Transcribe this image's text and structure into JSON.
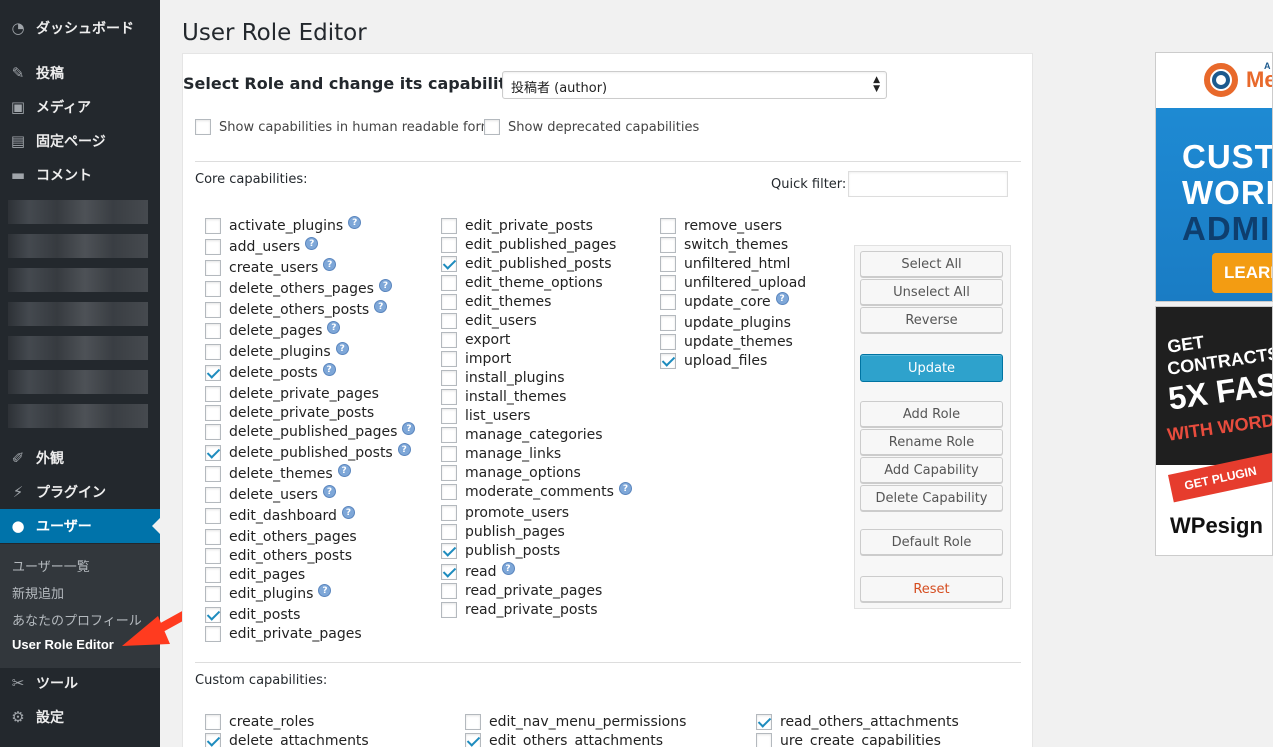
{
  "sidebar": {
    "items": [
      {
        "label": "ダッシュボード",
        "icon": "dashboard-icon"
      },
      {
        "label": "投稿",
        "icon": "pin-icon"
      },
      {
        "label": "メディア",
        "icon": "media-icon"
      },
      {
        "label": "固定ページ",
        "icon": "page-icon"
      },
      {
        "label": "コメント",
        "icon": "comment-icon"
      },
      {
        "label": "外観",
        "icon": "brush-icon"
      },
      {
        "label": "プラグイン",
        "icon": "plugin-icon"
      },
      {
        "label": "ユーザー",
        "icon": "users-icon"
      },
      {
        "label": "ツール",
        "icon": "wrench-icon"
      },
      {
        "label": "設定",
        "icon": "settings-icon"
      }
    ],
    "submenu": [
      "ユーザー一覧",
      "新規追加",
      "あなたのプロフィール",
      "User Role Editor"
    ]
  },
  "page": {
    "title": "User Role Editor",
    "role_label": "Select Role and change its capabilities:",
    "role_value": "投稿者 (author)",
    "human_readable_label": "Show capabilities in human readable form",
    "deprecated_label": "Show deprecated capabilities",
    "core_label": "Core capabilities:",
    "quick_filter_label": "Quick filter:",
    "custom_label": "Custom capabilities:"
  },
  "core_capabilities": {
    "col1": [
      {
        "name": "activate_plugins",
        "checked": false,
        "help": true
      },
      {
        "name": "add_users",
        "checked": false,
        "help": true
      },
      {
        "name": "create_users",
        "checked": false,
        "help": true
      },
      {
        "name": "delete_others_pages",
        "checked": false,
        "help": true
      },
      {
        "name": "delete_others_posts",
        "checked": false,
        "help": true
      },
      {
        "name": "delete_pages",
        "checked": false,
        "help": true
      },
      {
        "name": "delete_plugins",
        "checked": false,
        "help": true
      },
      {
        "name": "delete_posts",
        "checked": true,
        "help": true
      },
      {
        "name": "delete_private_pages",
        "checked": false,
        "help": false
      },
      {
        "name": "delete_private_posts",
        "checked": false,
        "help": false
      },
      {
        "name": "delete_published_pages",
        "checked": false,
        "help": true
      },
      {
        "name": "delete_published_posts",
        "checked": true,
        "help": true
      },
      {
        "name": "delete_themes",
        "checked": false,
        "help": true
      },
      {
        "name": "delete_users",
        "checked": false,
        "help": true
      },
      {
        "name": "edit_dashboard",
        "checked": false,
        "help": true
      },
      {
        "name": "edit_others_pages",
        "checked": false,
        "help": false
      },
      {
        "name": "edit_others_posts",
        "checked": false,
        "help": false
      },
      {
        "name": "edit_pages",
        "checked": false,
        "help": false
      },
      {
        "name": "edit_plugins",
        "checked": false,
        "help": true
      },
      {
        "name": "edit_posts",
        "checked": true,
        "help": false
      },
      {
        "name": "edit_private_pages",
        "checked": false,
        "help": false
      }
    ],
    "col2": [
      {
        "name": "edit_private_posts",
        "checked": false,
        "help": false
      },
      {
        "name": "edit_published_pages",
        "checked": false,
        "help": false
      },
      {
        "name": "edit_published_posts",
        "checked": true,
        "help": false
      },
      {
        "name": "edit_theme_options",
        "checked": false,
        "help": false
      },
      {
        "name": "edit_themes",
        "checked": false,
        "help": false
      },
      {
        "name": "edit_users",
        "checked": false,
        "help": false
      },
      {
        "name": "export",
        "checked": false,
        "help": false
      },
      {
        "name": "import",
        "checked": false,
        "help": false
      },
      {
        "name": "install_plugins",
        "checked": false,
        "help": false
      },
      {
        "name": "install_themes",
        "checked": false,
        "help": false
      },
      {
        "name": "list_users",
        "checked": false,
        "help": false
      },
      {
        "name": "manage_categories",
        "checked": false,
        "help": false
      },
      {
        "name": "manage_links",
        "checked": false,
        "help": false
      },
      {
        "name": "manage_options",
        "checked": false,
        "help": false
      },
      {
        "name": "moderate_comments",
        "checked": false,
        "help": true
      },
      {
        "name": "promote_users",
        "checked": false,
        "help": false
      },
      {
        "name": "publish_pages",
        "checked": false,
        "help": false
      },
      {
        "name": "publish_posts",
        "checked": true,
        "help": false
      },
      {
        "name": "read",
        "checked": true,
        "help": true
      },
      {
        "name": "read_private_pages",
        "checked": false,
        "help": false
      },
      {
        "name": "read_private_posts",
        "checked": false,
        "help": false
      }
    ],
    "col3": [
      {
        "name": "remove_users",
        "checked": false,
        "help": false
      },
      {
        "name": "switch_themes",
        "checked": false,
        "help": false
      },
      {
        "name": "unfiltered_html",
        "checked": false,
        "help": false
      },
      {
        "name": "unfiltered_upload",
        "checked": false,
        "help": false
      },
      {
        "name": "update_core",
        "checked": false,
        "help": true
      },
      {
        "name": "update_plugins",
        "checked": false,
        "help": false
      },
      {
        "name": "update_themes",
        "checked": false,
        "help": false
      },
      {
        "name": "upload_files",
        "checked": true,
        "help": false
      }
    ]
  },
  "custom_capabilities": [
    {
      "name": "create_roles",
      "checked": false
    },
    {
      "name": "edit_nav_menu_permissions",
      "checked": false
    },
    {
      "name": "read_others_attachments",
      "checked": true
    },
    {
      "name": "delete_attachments",
      "checked": true
    },
    {
      "name": "edit_others_attachments",
      "checked": true
    },
    {
      "name": "ure_create_capabilities",
      "checked": false
    }
  ],
  "buttons": {
    "select_all": "Select All",
    "unselect_all": "Unselect All",
    "reverse": "Reverse",
    "update": "Update",
    "add_role": "Add Role",
    "rename_role": "Rename Role",
    "add_capability": "Add Capability",
    "delete_capability": "Delete Capability",
    "default_role": "Default Role",
    "reset": "Reset"
  },
  "ads": {
    "ad1": {
      "brand": "Me",
      "brand_small": "A",
      "line1": "CUSTO",
      "line2": "WORD",
      "line3": "ADMIN",
      "cta": "LEARN"
    },
    "ad2": {
      "line1": "GET",
      "line2": "CONTRACTS",
      "line3": "5X FAS",
      "line4": "WITH WORD",
      "cta": "GET PLUGIN",
      "logo": "WPesign"
    }
  },
  "colors": {
    "sidebar_bg": "#23282d",
    "accent": "#0073aa",
    "primary_button": "#2ea2cc",
    "arrow": "#ff3b1f"
  }
}
